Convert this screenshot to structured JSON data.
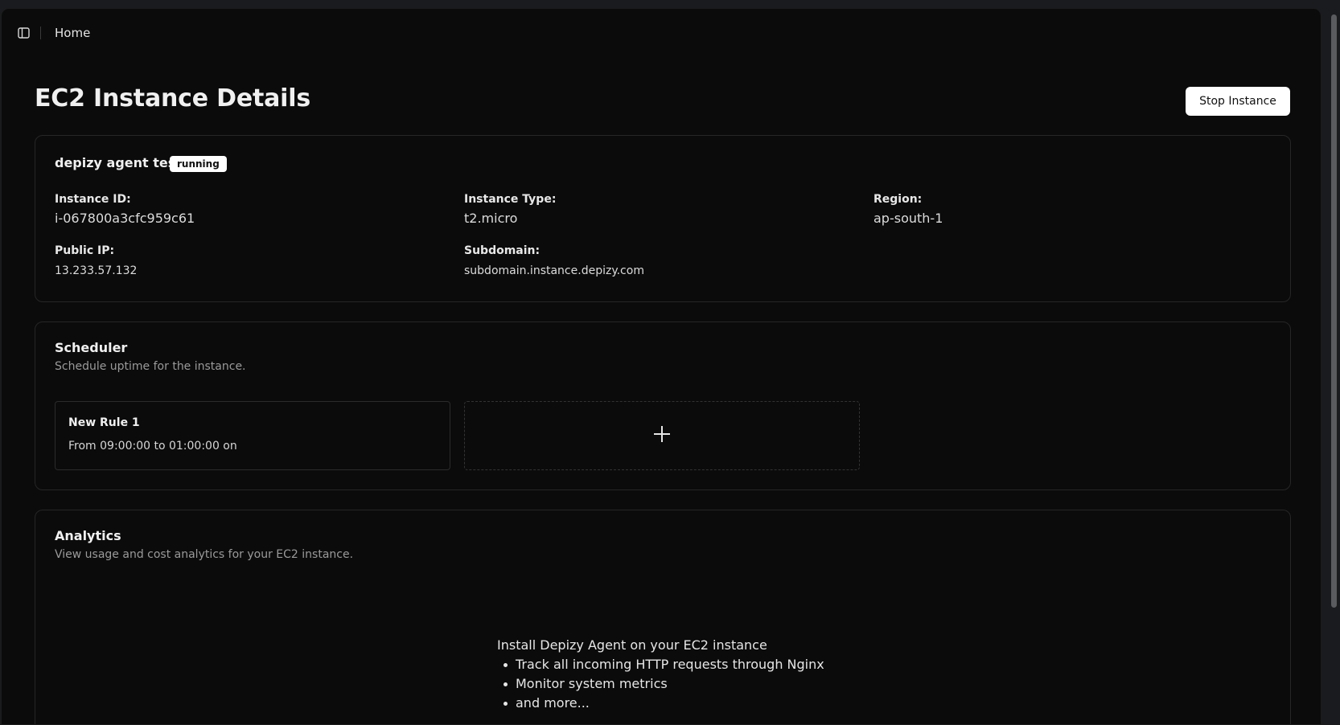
{
  "header": {
    "breadcrumb": "Home"
  },
  "page": {
    "title": "EC2 Instance Details",
    "stop_button_label": "Stop Instance"
  },
  "instance": {
    "name": "depizy agent test",
    "status": "running",
    "fields": {
      "instance_id_label": "Instance ID:",
      "instance_id": "i-067800a3cfc959c61",
      "instance_type_label": "Instance Type:",
      "instance_type": "t2.micro",
      "region_label": "Region:",
      "region": "ap-south-1",
      "public_ip_label": "Public IP:",
      "public_ip": "13.233.57.132",
      "subdomain_label": "Subdomain:",
      "subdomain": "subdomain.instance.depizy.com"
    }
  },
  "scheduler": {
    "title": "Scheduler",
    "subtitle": "Schedule uptime for the instance.",
    "rules": [
      {
        "title": "New Rule 1",
        "description": "From 09:00:00 to 01:00:00 on"
      }
    ]
  },
  "analytics": {
    "title": "Analytics",
    "subtitle": "View usage and cost analytics for your EC2 instance.",
    "promo_heading": "Install Depizy Agent on your EC2 instance",
    "promo_items": [
      "Track all incoming HTTP requests through Nginx",
      "Monitor system metrics",
      "and more..."
    ]
  },
  "icons": {
    "sidebar_toggle": "sidebar-toggle-icon",
    "add_rule": "plus-icon"
  },
  "colors": {
    "background": "#0b0b0b",
    "badge_bg": "#ffffff",
    "button_bg": "#ffffff",
    "border": "#262626"
  }
}
